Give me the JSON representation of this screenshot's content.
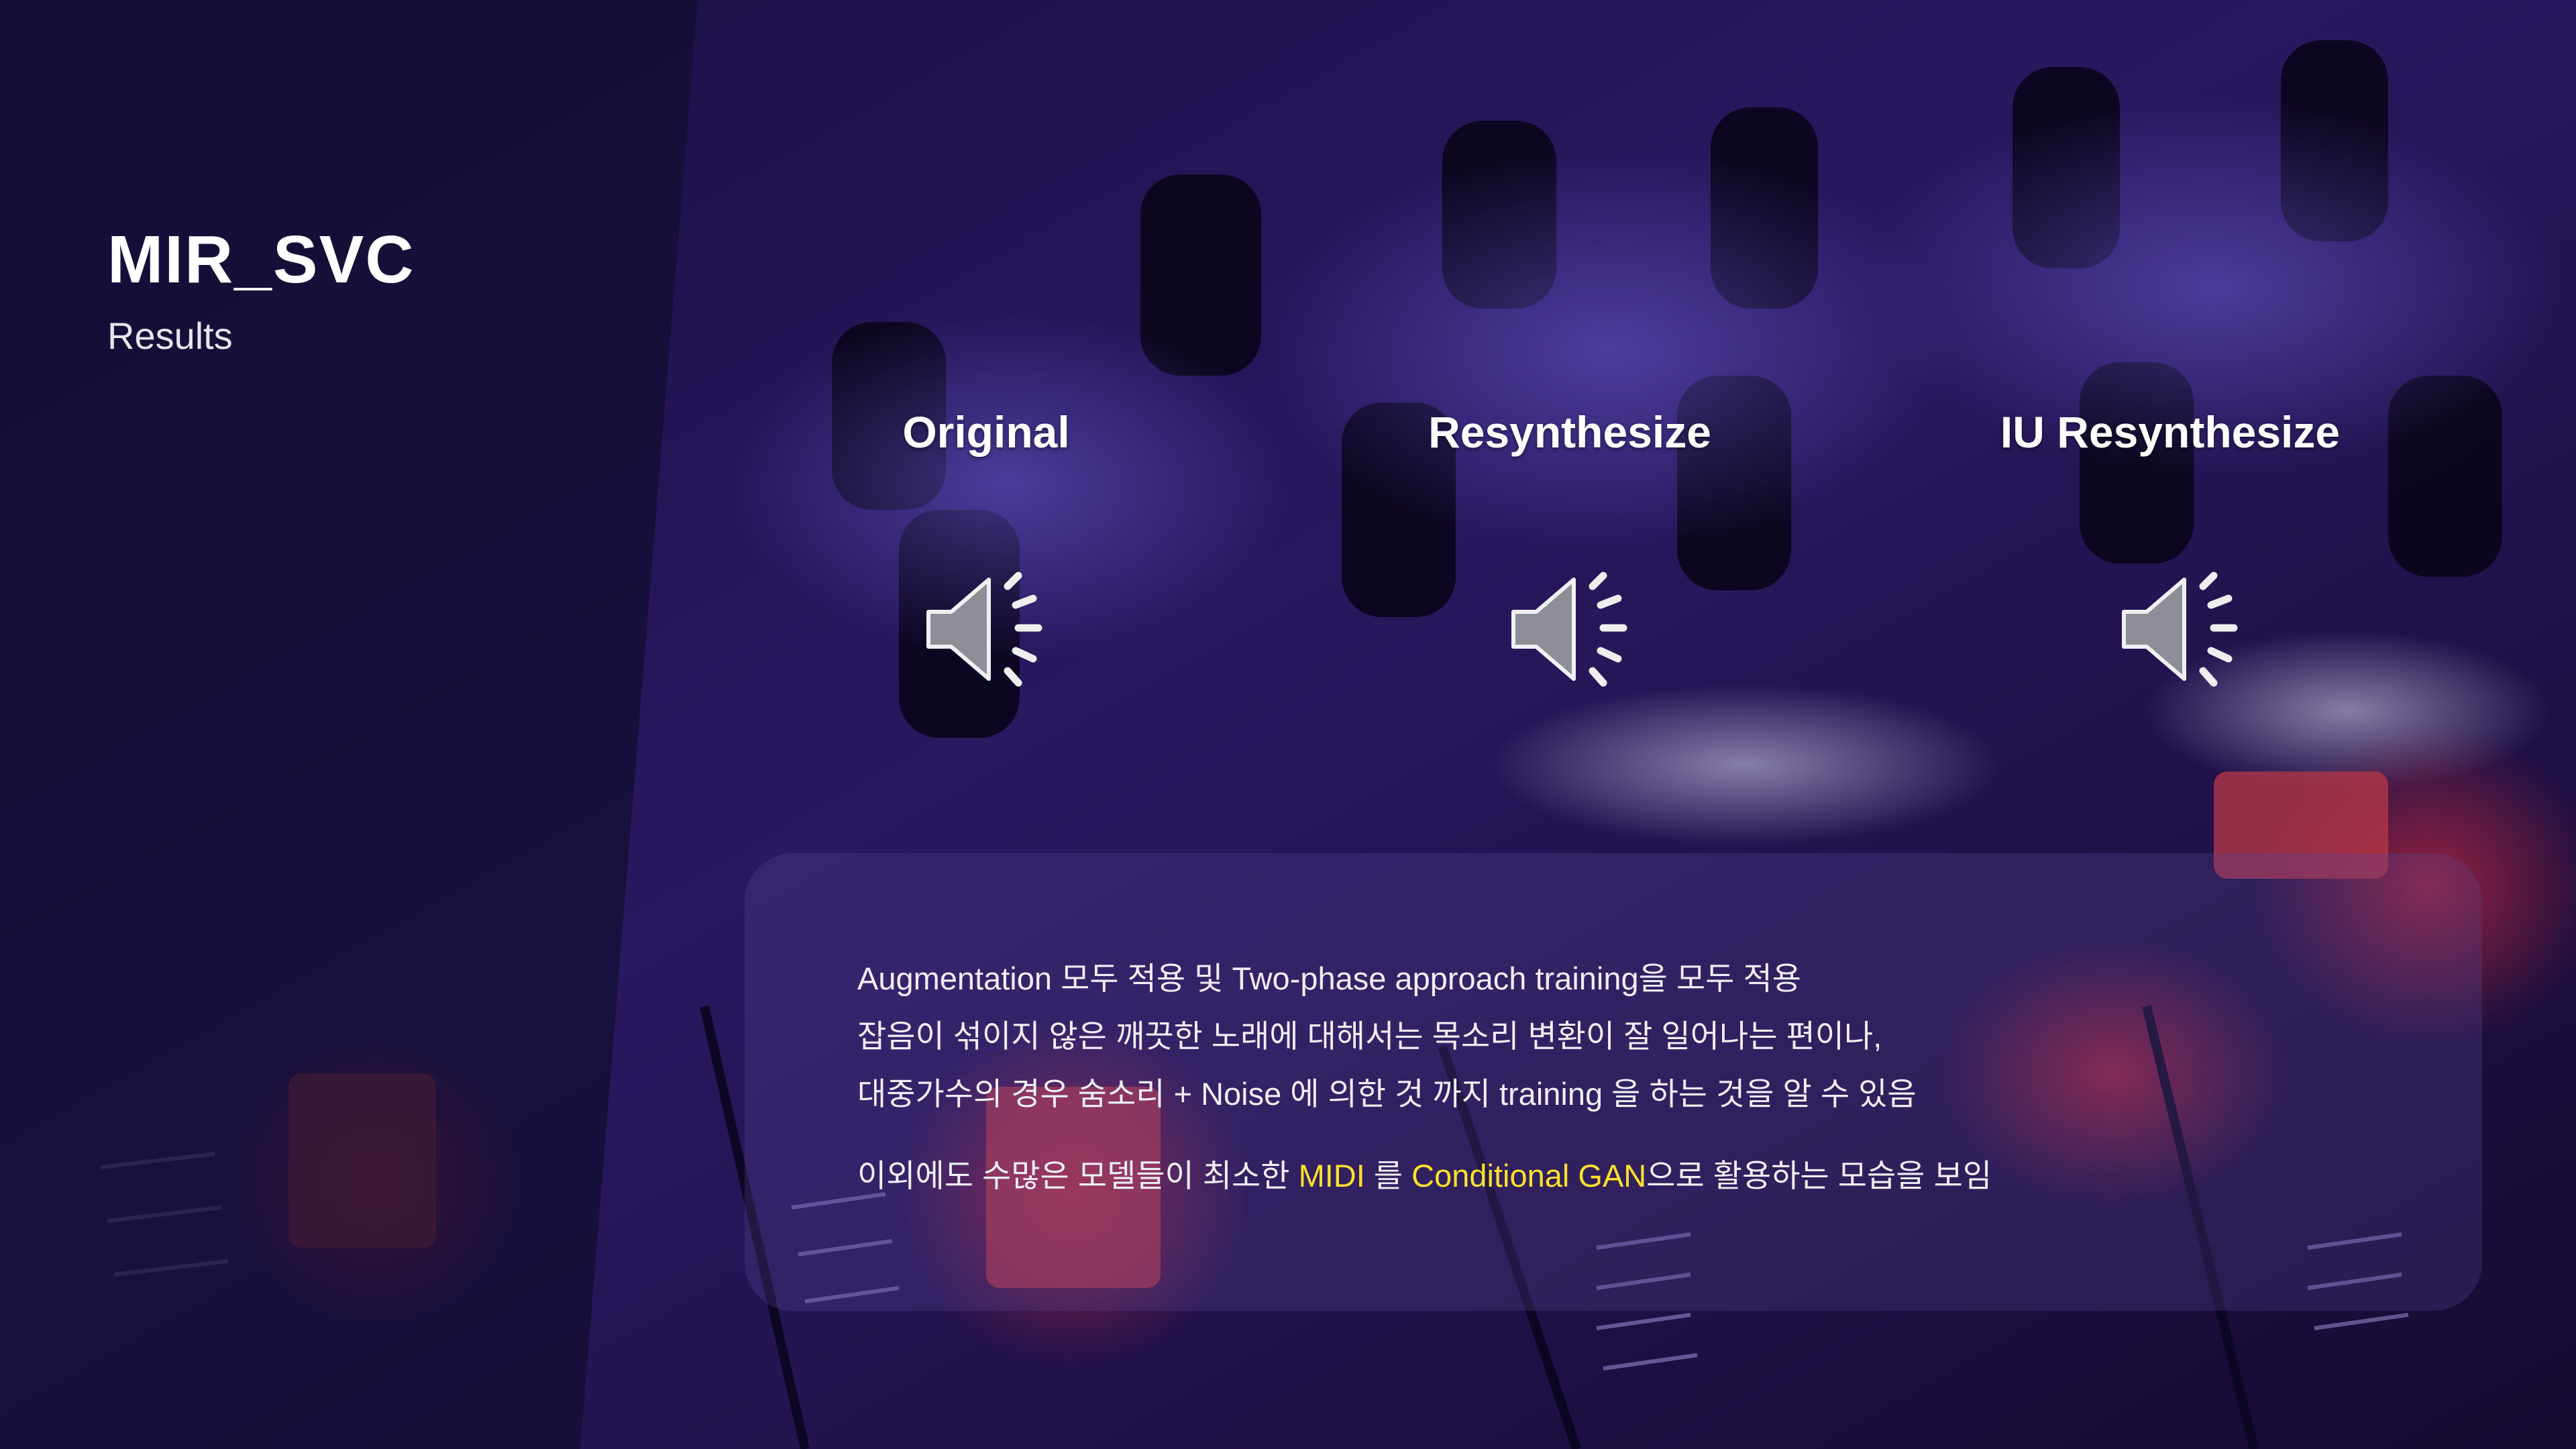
{
  "slide": {
    "title": "MIR_SVC",
    "subtitle": "Results"
  },
  "audio_items": [
    {
      "label": "Original",
      "icon": "speaker-icon"
    },
    {
      "label": "Resynthesize",
      "icon": "speaker-icon"
    },
    {
      "label": "IU Resynthesize",
      "icon": "speaker-icon"
    }
  ],
  "notes": {
    "line1": "Augmentation 모두 적용 및 Two-phase approach training을 모두 적용",
    "line2": "잡음이 섞이지 않은 깨끗한 노래에 대해서는 목소리 변환이 잘 일어나는 편이나,",
    "line3": "대중가수의 경우 숨소리 + Noise 에 의한 것 까지 training 을 하는 것을 알 수 있음",
    "line4": {
      "part1": "이외에도 수많은 모델들이 최소한 ",
      "hl1": "MIDI",
      "part2": " 를 ",
      "hl2": "Conditional GAN",
      "part3": "으로 활용하는 모습을 보임"
    }
  },
  "colors": {
    "highlight": "#ffe02a",
    "background": "#120a2e"
  }
}
